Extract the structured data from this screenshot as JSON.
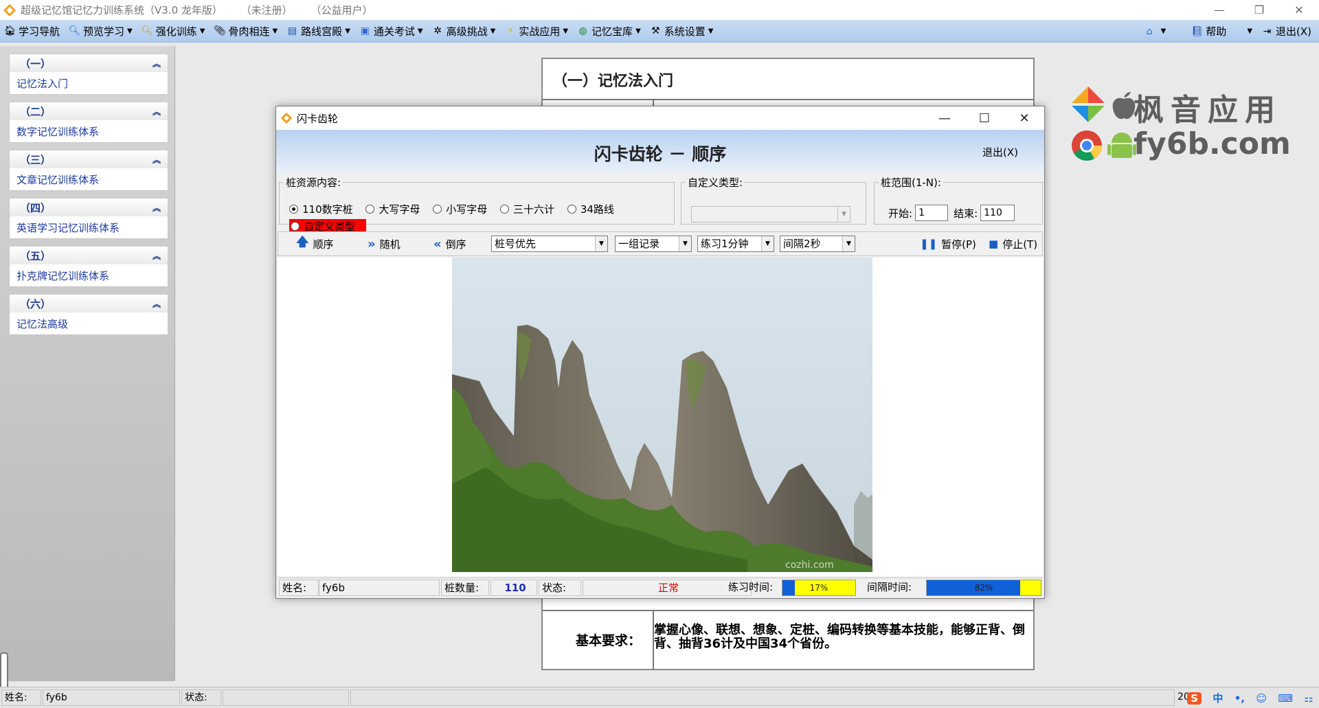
{
  "window": {
    "title_parts": [
      "超级记忆馆记忆力训练系统（V3.0 龙年版）",
      "（未注册）",
      "（公益用户）"
    ],
    "minimize": "—",
    "restore": "❐",
    "close": "✕"
  },
  "menu": {
    "items": [
      {
        "label": "学习导航",
        "icon": "house-icon",
        "caret": false
      },
      {
        "label": "预览学习",
        "icon": "magnifier-icon",
        "caret": true
      },
      {
        "label": "强化训练",
        "icon": "search-icon",
        "caret": true
      },
      {
        "label": "骨肉相连",
        "icon": "clip-icon",
        "caret": true
      },
      {
        "label": "路线宫殿",
        "icon": "list-icon",
        "caret": true
      },
      {
        "label": "通关考试",
        "icon": "window-icon",
        "caret": true
      },
      {
        "label": "高级挑战",
        "icon": "network-icon",
        "caret": true
      },
      {
        "label": "实战应用",
        "icon": "lightning-icon",
        "caret": true
      },
      {
        "label": "记忆宝库",
        "icon": "globe-icon",
        "caret": true
      },
      {
        "label": "系统设置",
        "icon": "wrench-icon",
        "caret": true
      }
    ],
    "help": "帮助",
    "exit": "退出(X)"
  },
  "sidebar": {
    "sections": [
      {
        "head": "（一）",
        "body": "记忆法入门"
      },
      {
        "head": "（二）",
        "body": "数字记忆训练体系"
      },
      {
        "head": "（三）",
        "body": "文章记忆训练体系"
      },
      {
        "head": "（四）",
        "body": "英语学习记忆训练体系"
      },
      {
        "head": "（五）",
        "body": "扑克牌记忆训练体系"
      },
      {
        "head": "（六）",
        "body": "记忆法高级"
      }
    ]
  },
  "doc": {
    "title": "（一）记忆法入门",
    "req_label": "基本要求：",
    "req_text": "掌握心像、联想、想象、定桩、编码转换等基本技能，能够正背、倒背、抽背36计及中国34个省份。"
  },
  "watermark": {
    "line1": "枫音应用",
    "line2": "fy6b.com"
  },
  "dialog": {
    "title": "闪卡齿轮",
    "heading": "闪卡齿轮 － 顺序",
    "exit": "退出(X)",
    "source": {
      "legend": "桩资源内容:",
      "options": [
        {
          "label": "110数字桩",
          "checked": true
        },
        {
          "label": "大写字母",
          "checked": false
        },
        {
          "label": "小写字母",
          "checked": false
        },
        {
          "label": "三十六计",
          "checked": false
        },
        {
          "label": "34路线",
          "checked": false
        }
      ],
      "custom_option": "自定义类型"
    },
    "custom_type": {
      "legend": "自定义类型:",
      "value": ""
    },
    "range": {
      "legend": "桩范围(1-N):",
      "start_label": "开始:",
      "start_value": "1",
      "end_label": "结束:",
      "end_value": "110"
    },
    "toolbar": {
      "sequential": "顺序",
      "random": "随机",
      "reverse": "倒序",
      "order_select": "桩号优先",
      "record_select": "一组记录",
      "duration_select": "练习1分钟",
      "interval_select": "间隔2秒",
      "pause": "暂停(P)",
      "stop": "停止(T)"
    },
    "status": {
      "name_label": "姓名:",
      "name_value": "fy6b",
      "count_label": "桩数量:",
      "count_value": "110",
      "state_label": "状态:",
      "state_value": "正常",
      "practice_label": "练习时间:",
      "practice_text": "17%",
      "practice_progress": 0.17,
      "interval_label": "间隔时间:",
      "interval_text": "82%",
      "interval_progress": 0.82
    },
    "photo_watermark": "cozhi.com"
  },
  "bottom": {
    "name_label": "姓名:",
    "name_value": "fy6b",
    "state_label": "状态:",
    "year_fragment": "20",
    "tray": [
      "S",
      "中",
      "•,",
      "☺",
      "⌨",
      "⚏"
    ]
  },
  "colors": {
    "menubar": "#aecbee",
    "red_highlight": "#ff0000",
    "progress_fill": "#1060d8",
    "progress_bg": "#ffff00",
    "state_text": "#e00000",
    "count_text": "#1a2fb0"
  }
}
